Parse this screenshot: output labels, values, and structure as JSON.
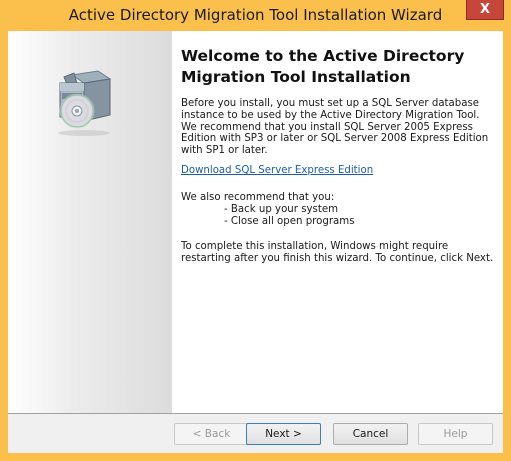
{
  "window": {
    "title": "Active Directory Migration Tool Installation Wizard",
    "close_glyph": "X",
    "accent_color": "#fbc04b",
    "close_color": "#c7463a"
  },
  "sidebar": {
    "icon": "software-box-cd-icon"
  },
  "content": {
    "heading": "Welcome to the Active Directory Migration Tool Installation",
    "paragraph1": "Before you install, you must set up a SQL Server database instance to be used by the Active Directory Migration Tool. We recommend that you install SQL Server 2005 Express Edition with SP3 or later or SQL Server 2008 Express Edition with SP1 or later.",
    "download_link": "Download SQL Server Express Edition",
    "paragraph2": "We also recommend that you:",
    "recommendations": [
      "- Back up your system",
      "- Close all open programs"
    ],
    "paragraph3": "To complete this installation, Windows might require restarting after you finish this wizard. To continue, click Next."
  },
  "footer": {
    "back_label": "< Back",
    "next_label": "Next >",
    "cancel_label": "Cancel",
    "help_label": "Help",
    "back_enabled": false,
    "help_enabled": false
  }
}
